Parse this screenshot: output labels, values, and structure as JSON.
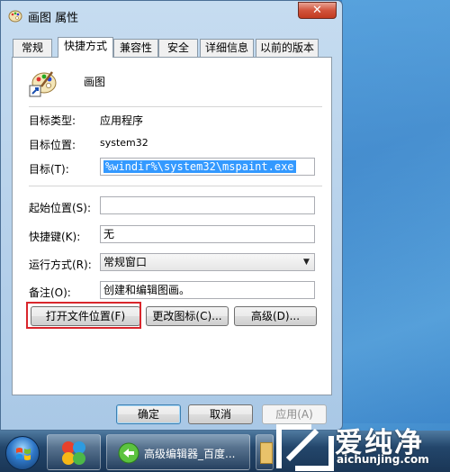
{
  "window": {
    "title": "画图 属性",
    "icon": "paint-palette-icon",
    "close_label": "✕"
  },
  "tabs": [
    {
      "label": "常规",
      "active": false
    },
    {
      "label": "快捷方式",
      "active": true
    },
    {
      "label": "兼容性",
      "active": false
    },
    {
      "label": "安全",
      "active": false
    },
    {
      "label": "详细信息",
      "active": false
    },
    {
      "label": "以前的版本",
      "active": false
    }
  ],
  "shortcut": {
    "app_name": "画图",
    "target_type_label": "目标类型:",
    "target_type_value": "应用程序",
    "target_location_label": "目标位置:",
    "target_location_value": "system32",
    "target_label": "目标(T):",
    "target_value": "%windir%\\system32\\mspaint.exe",
    "start_in_label": "起始位置(S):",
    "start_in_value": "",
    "hotkey_label": "快捷键(K):",
    "hotkey_value": "无",
    "run_label": "运行方式(R):",
    "run_value": "常规窗口",
    "comment_label": "备注(O):",
    "comment_value": "创建和编辑图画。"
  },
  "panel_buttons": {
    "open_location": "打开文件位置(F)",
    "change_icon": "更改图标(C)...",
    "advanced": "高级(D)..."
  },
  "dialog_buttons": {
    "ok": "确定",
    "cancel": "取消",
    "apply": "应用(A)"
  },
  "taskbar": {
    "item_label": "高级编辑器_百度..."
  },
  "watermark": {
    "text": "爱纯净",
    "url": "aichunjing.com"
  },
  "colors": {
    "highlight_box": "#d9262c",
    "selection": "#3399ff"
  }
}
